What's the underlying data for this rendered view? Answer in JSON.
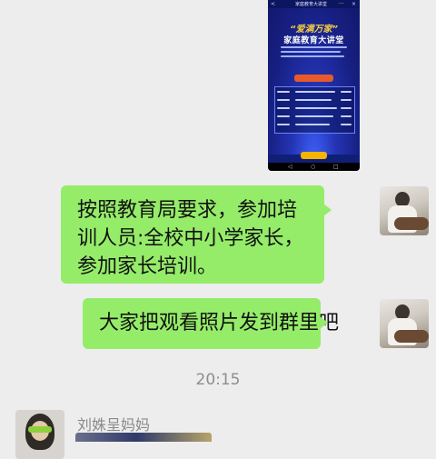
{
  "chat": {
    "image_card": {
      "header_title": "家庭教育大讲堂",
      "back_glyph": "<",
      "close_glyph": "×",
      "more_glyph": "···",
      "quote_title": "“爱满万家”",
      "main_title": "家庭教育大讲堂",
      "section_label": "课程安排",
      "nav_back": "◁",
      "nav_home": "○",
      "nav_recent": "□"
    },
    "messages": [
      {
        "text": "按照教育局要求，参加培训人员:全校中小学家长，参加家长培训。"
      },
      {
        "text": "大家把观看照片发到群里吧"
      }
    ],
    "timestamp": "20:15",
    "incoming": {
      "sender_name": "刘姝呈妈妈"
    }
  },
  "colors": {
    "background": "#ededed",
    "bubble_green": "#95ec69",
    "timestamp_gray": "#8d8d8d"
  }
}
